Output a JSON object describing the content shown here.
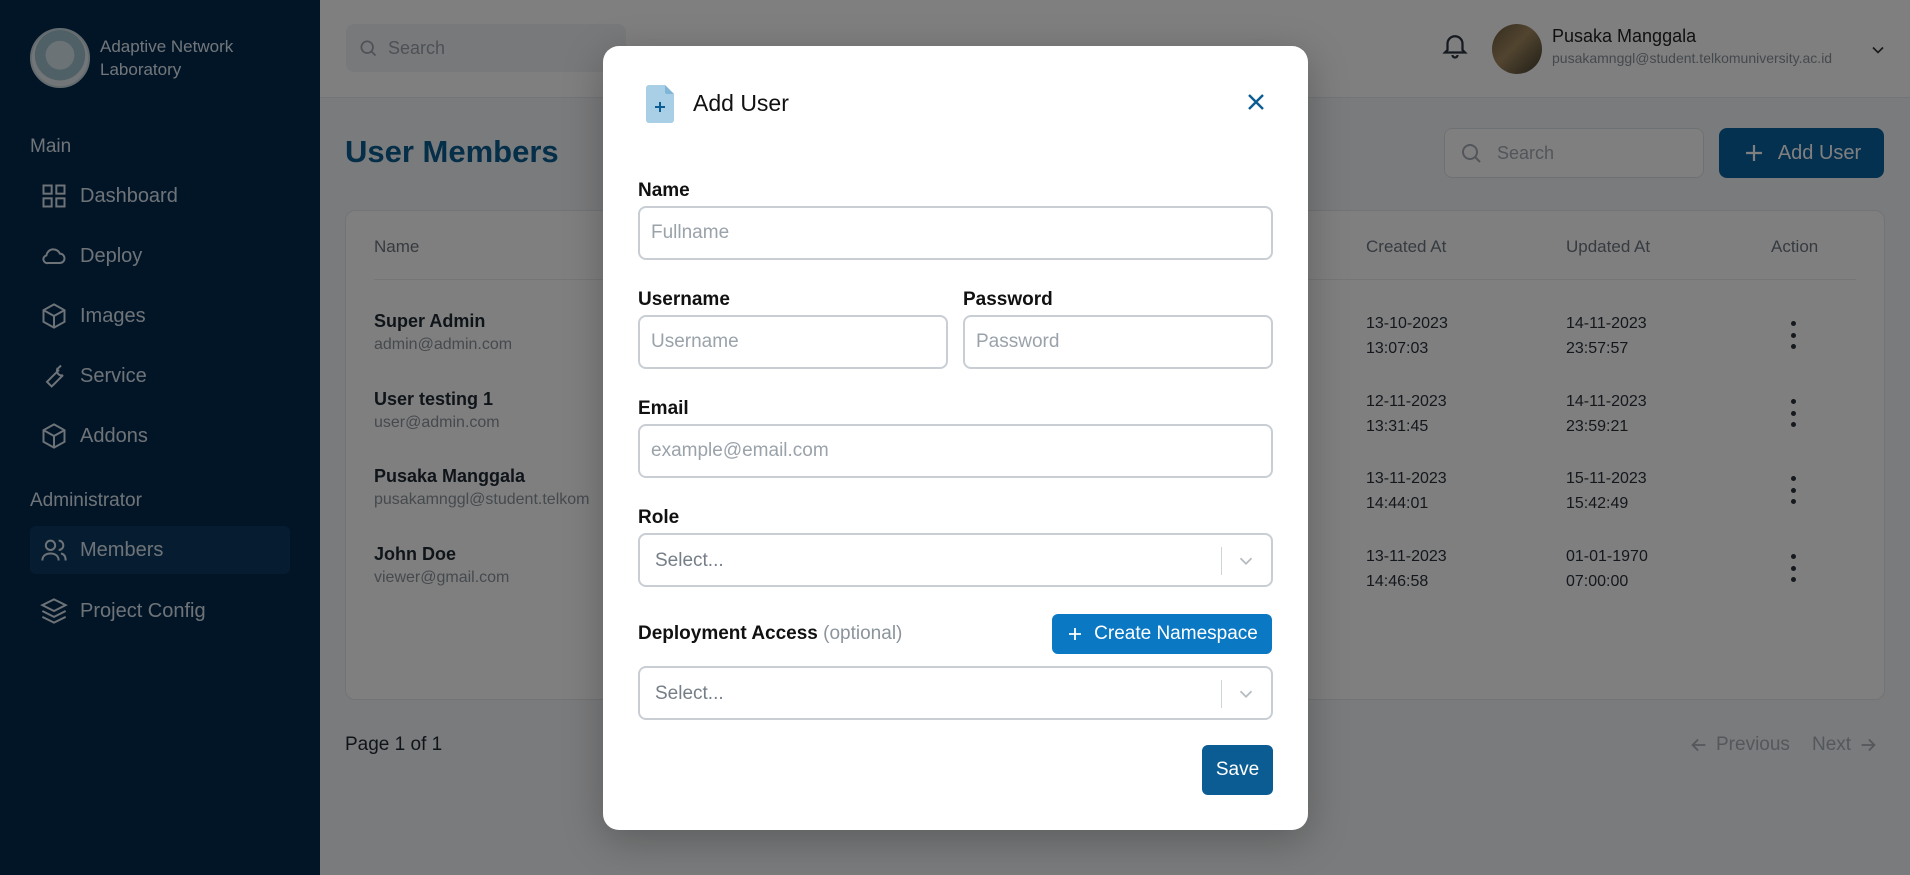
{
  "sidebar": {
    "brand_name": "Adaptive Network Laboratory",
    "sections": {
      "main": "Main",
      "administrator": "Administrator"
    },
    "items": [
      {
        "label": "Dashboard",
        "icon": "dashboard-icon"
      },
      {
        "label": "Deploy",
        "icon": "cloud-icon"
      },
      {
        "label": "Images",
        "icon": "cube-icon"
      },
      {
        "label": "Service",
        "icon": "wrench-icon"
      },
      {
        "label": "Addons",
        "icon": "cube-icon"
      },
      {
        "label": "Members",
        "icon": "users-icon"
      },
      {
        "label": "Project Config",
        "icon": "layers-icon"
      }
    ],
    "active_item": "Members"
  },
  "topbar": {
    "search_placeholder": "Search",
    "user_name": "Pusaka Manggala",
    "user_email": "pusakamnggl@student.telkomuniversity.ac.id"
  },
  "main": {
    "title": "User Members",
    "search_placeholder": "Search",
    "add_user_label": "Add User",
    "columns": {
      "name": "Name",
      "created_at": "Created At",
      "updated_at": "Updated At",
      "action": "Action"
    },
    "rows": [
      {
        "name": "Super Admin",
        "email": "admin@admin.com",
        "created_date": "13-10-2023",
        "created_time": "13:07:03",
        "updated_date": "14-11-2023",
        "updated_time": "23:57:57"
      },
      {
        "name": "User testing 1",
        "email": "user@admin.com",
        "created_date": "12-11-2023",
        "created_time": "13:31:45",
        "updated_date": "14-11-2023",
        "updated_time": "23:59:21"
      },
      {
        "name": "Pusaka Manggala",
        "email": "pusakamnggl@student.telkom",
        "created_date": "13-11-2023",
        "created_time": "14:44:01",
        "updated_date": "15-11-2023",
        "updated_time": "15:42:49"
      },
      {
        "name": "John Doe",
        "email": "viewer@gmail.com",
        "created_date": "13-11-2023",
        "created_time": "14:46:58",
        "updated_date": "01-01-1970",
        "updated_time": "07:00:00"
      }
    ],
    "pager": {
      "text": "Page 1 of 1",
      "previous": "Previous",
      "next": "Next"
    }
  },
  "modal": {
    "title": "Add User",
    "name_label": "Name",
    "name_placeholder": "Fullname",
    "username_label": "Username",
    "username_placeholder": "Username",
    "password_label": "Password",
    "password_placeholder": "Password",
    "email_label": "Email",
    "email_placeholder": "example@email.com",
    "role_label": "Role",
    "role_select_placeholder": "Select...",
    "deployment_label": "Deployment Access",
    "deployment_optional": "(optional)",
    "create_namespace_label": "Create Namespace",
    "deployment_select_placeholder": "Select...",
    "save_label": "Save"
  },
  "colors": {
    "sidebar_bg": "#022a4e",
    "primary": "#0b5c92",
    "create_button": "#0b78c3"
  }
}
